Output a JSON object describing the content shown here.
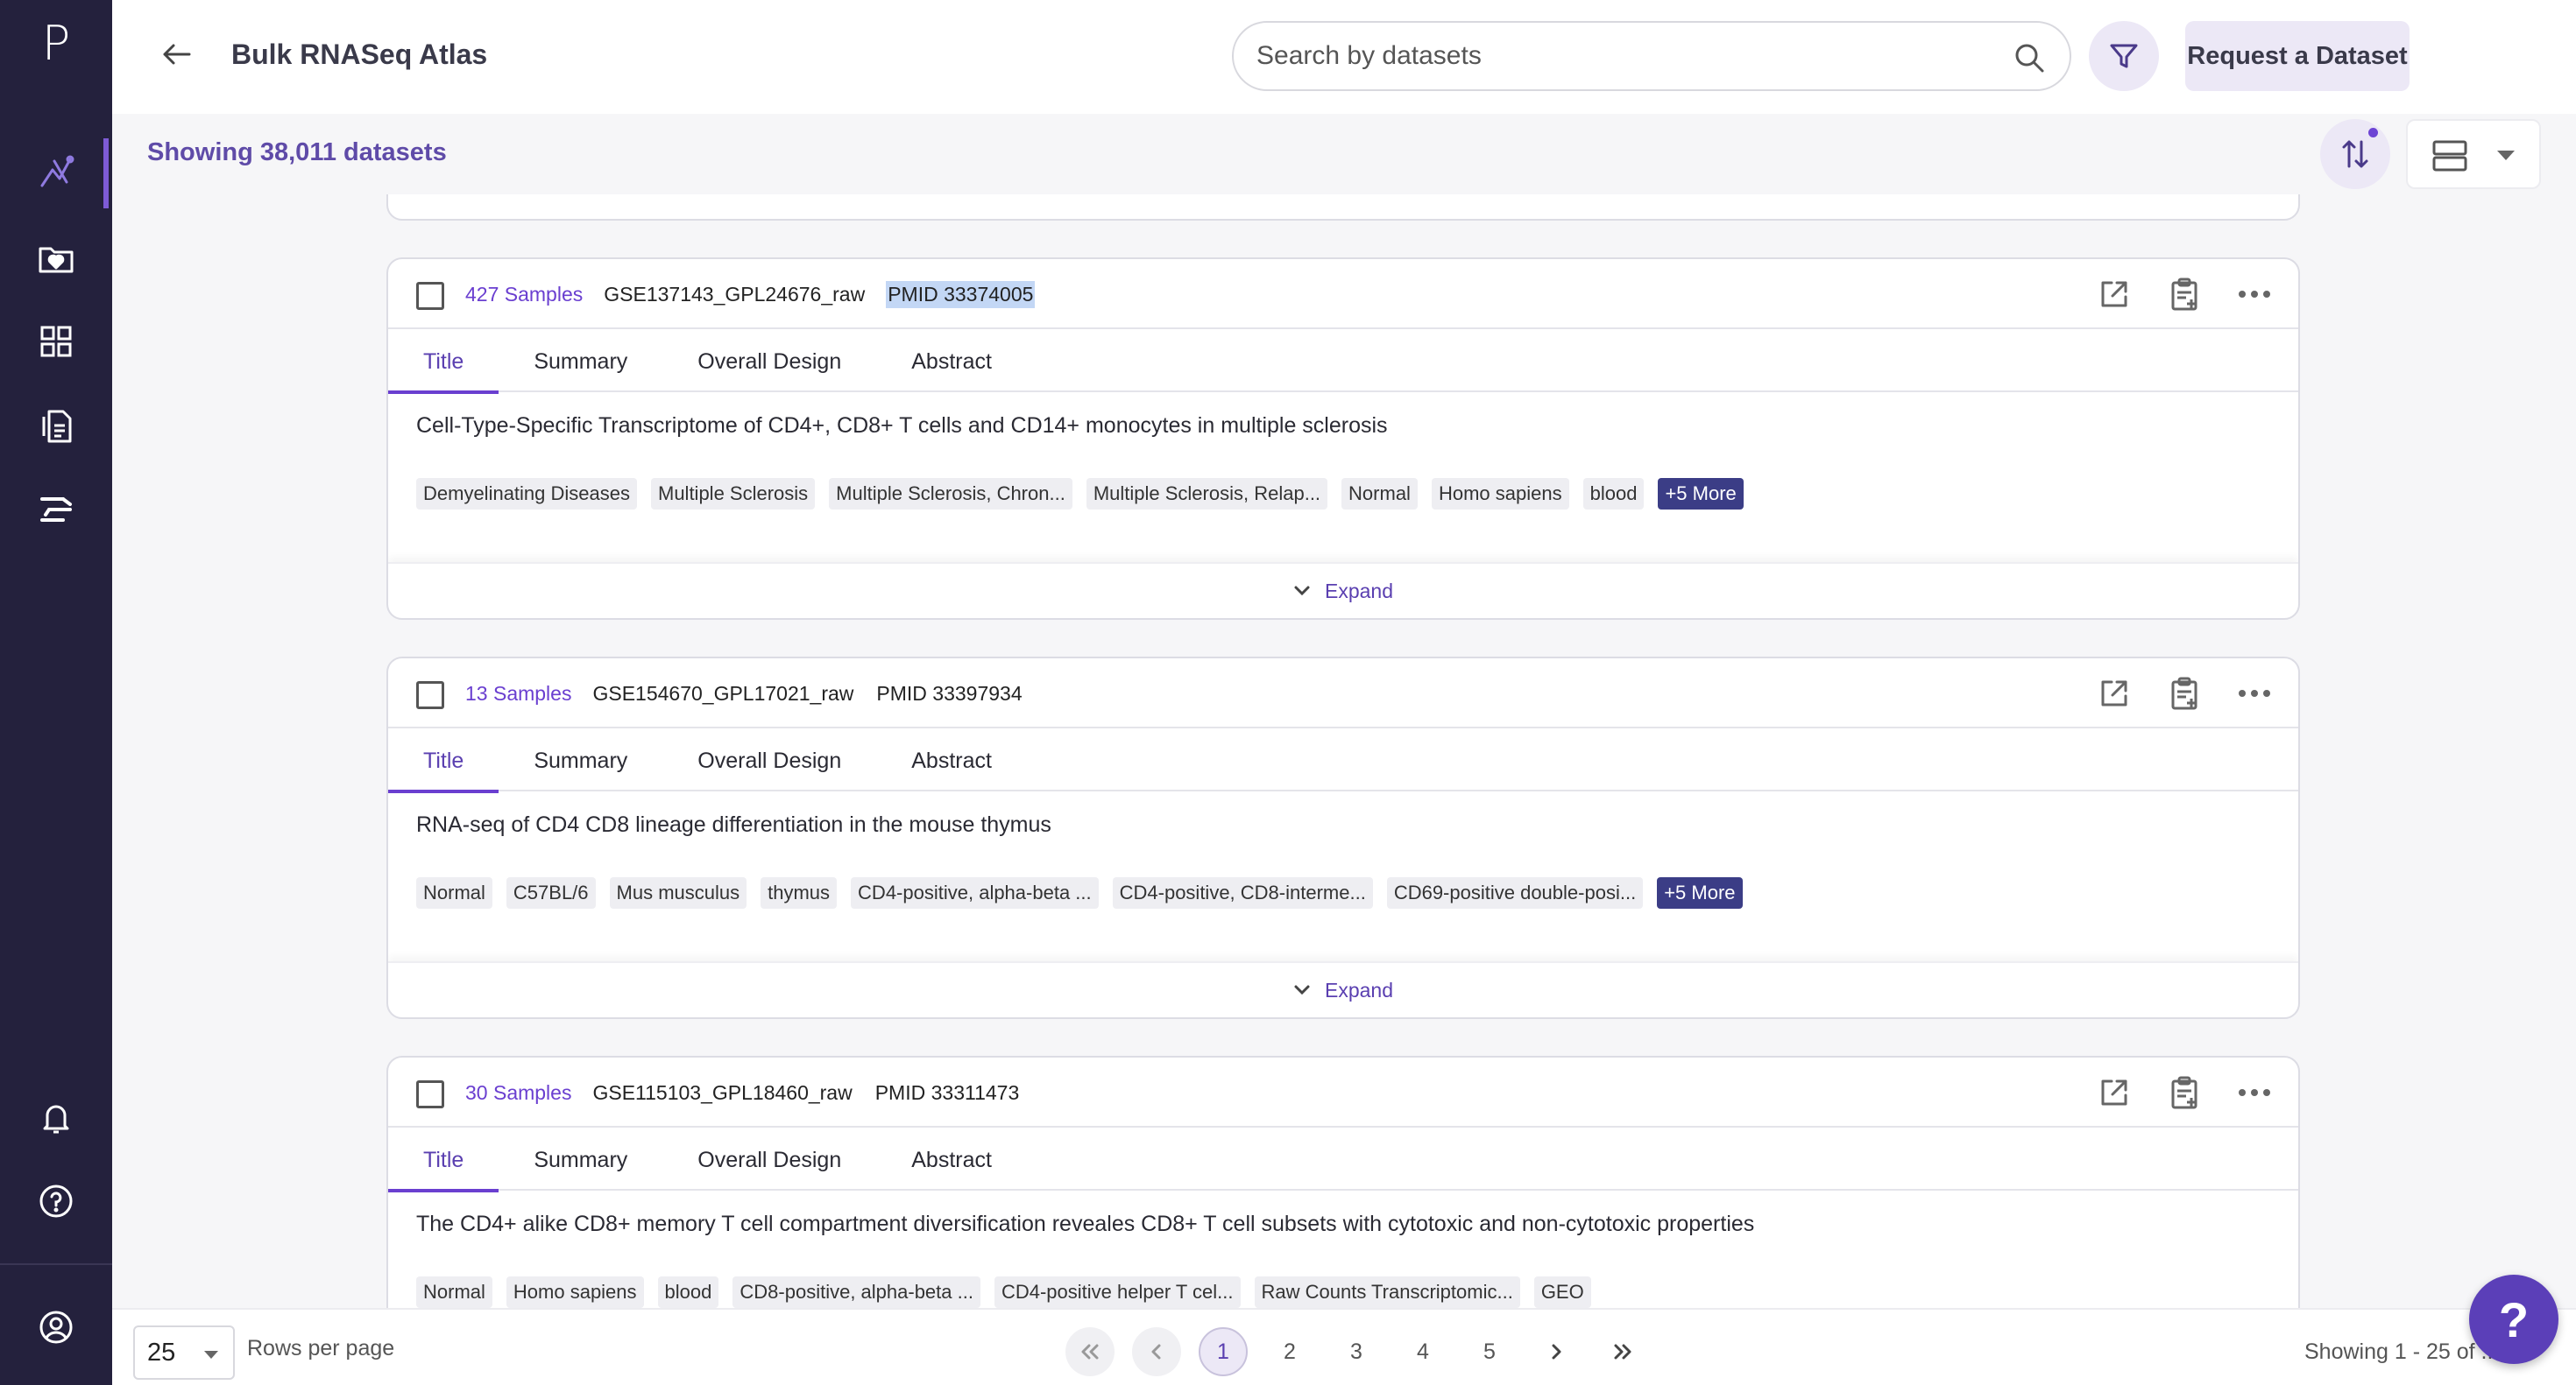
{
  "app": {
    "logo": "P"
  },
  "header": {
    "title": "Bulk RNASeq Atlas",
    "search_placeholder": "Search by datasets",
    "request_label": "Request a Dataset",
    "showing": "Showing 38,011 datasets"
  },
  "sidebar": {
    "items": [
      {
        "icon": "pipeline-icon",
        "active": true
      },
      {
        "icon": "heart-folder-icon"
      },
      {
        "icon": "grid-icon"
      },
      {
        "icon": "files-icon"
      },
      {
        "icon": "workflow-icon"
      }
    ],
    "bottom": [
      {
        "icon": "bell-icon"
      },
      {
        "icon": "help-circle-icon"
      },
      {
        "icon": "user-circle-icon"
      }
    ]
  },
  "tabs": [
    "Title",
    "Summary",
    "Overall Design",
    "Abstract"
  ],
  "expand_label": "Expand",
  "cards": [
    {
      "samples": "427 Samples",
      "gse": "GSE137143_GPL24676_raw",
      "pmid": "PMID 33374005",
      "title": "Cell-Type-Specific Transcriptome of CD4+, CD8+ T cells and CD14+ monocytes in multiple sclerosis",
      "tags": [
        "Demyelinating Diseases",
        "Multiple Sclerosis",
        "Multiple Sclerosis, Chron...",
        "Multiple Sclerosis, Relap...",
        "Normal",
        "Homo sapiens",
        "blood"
      ],
      "more": "+5 More"
    },
    {
      "samples": "13 Samples",
      "gse": "GSE154670_GPL17021_raw",
      "pmid": "PMID 33397934",
      "title": "RNA-seq of CD4 CD8 lineage differentiation in the mouse thymus",
      "tags": [
        "Normal",
        "C57BL/6",
        "Mus musculus",
        "thymus",
        "CD4-positive, alpha-beta ...",
        "CD4-positive, CD8-interme...",
        "CD69-positive double-posi..."
      ],
      "more": "+5 More"
    },
    {
      "samples": "30 Samples",
      "gse": "GSE115103_GPL18460_raw",
      "pmid": "PMID 33311473",
      "title": "The CD4+ alike CD8+ memory T cell compartment diversification reveales CD8+ T cell subsets with cytotoxic and non-cytotoxic properties",
      "tags": [
        "Normal",
        "Homo sapiens",
        "blood",
        "CD8-positive, alpha-beta ...",
        "CD4-positive helper T cel...",
        "Raw Counts Transcriptomic...",
        "GEO"
      ],
      "more": ""
    }
  ],
  "footer": {
    "rows_value": "25",
    "rows_label": "Rows per page",
    "pages": [
      "1",
      "2",
      "3",
      "4",
      "5"
    ],
    "range": "Showing 1 - 25 of ...1"
  },
  "help_label": "?"
}
